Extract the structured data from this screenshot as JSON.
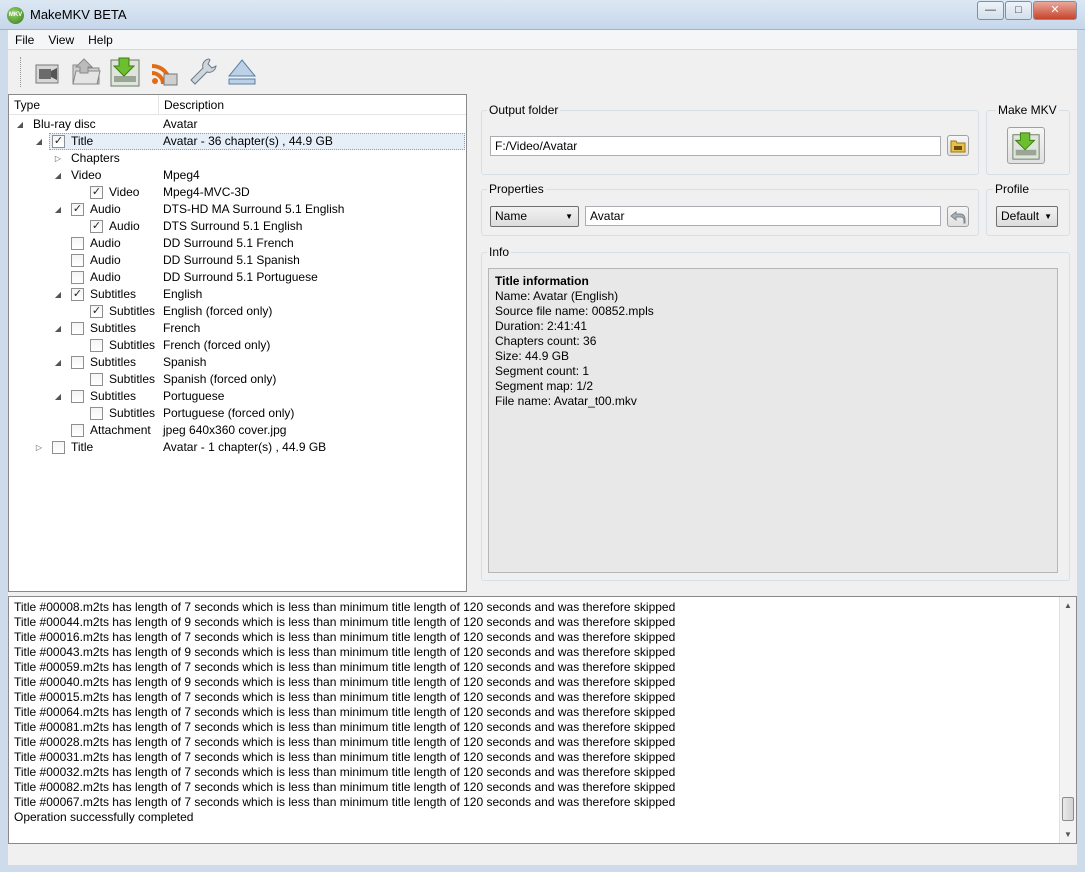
{
  "window": {
    "title": "MakeMKV BETA",
    "app_icon_text": "MKV",
    "minimize": "—",
    "maximize": "□",
    "close": "✕"
  },
  "menu": [
    {
      "label": "File"
    },
    {
      "label": "View"
    },
    {
      "label": "Help"
    }
  ],
  "toolbar": [
    {
      "icon": "open-file-icon"
    },
    {
      "icon": "open-folder-icon"
    },
    {
      "icon": "make-mkv-icon"
    },
    {
      "icon": "stream-icon"
    },
    {
      "icon": "settings-wrench-icon"
    },
    {
      "icon": "eject-icon"
    }
  ],
  "tree": {
    "columns": {
      "type": "Type",
      "description": "Description"
    },
    "rows": [
      {
        "label": "Blu-ray disc",
        "desc": "Avatar",
        "level": 0,
        "expander": "open",
        "checkbox": null
      },
      {
        "label": "Title",
        "desc": "Avatar - 36 chapter(s) , 44.9 GB",
        "level": 1,
        "expander": "open",
        "checkbox": true,
        "selected": true
      },
      {
        "label": "Chapters",
        "desc": "",
        "level": 2,
        "expander": "closed",
        "checkbox": null
      },
      {
        "label": "Video",
        "desc": "Mpeg4",
        "level": 2,
        "expander": "open",
        "checkbox": null
      },
      {
        "label": "Video",
        "desc": "Mpeg4-MVC-3D",
        "level": 3,
        "expander": null,
        "checkbox": true
      },
      {
        "label": "Audio",
        "desc": "DTS-HD MA Surround 5.1 English",
        "level": 2,
        "expander": "open",
        "checkbox": true
      },
      {
        "label": "Audio",
        "desc": "DTS Surround 5.1 English",
        "level": 3,
        "expander": null,
        "checkbox": true
      },
      {
        "label": "Audio",
        "desc": "DD Surround 5.1 French",
        "level": 2,
        "expander": null,
        "checkbox": false
      },
      {
        "label": "Audio",
        "desc": "DD Surround 5.1 Spanish",
        "level": 2,
        "expander": null,
        "checkbox": false
      },
      {
        "label": "Audio",
        "desc": "DD Surround 5.1 Portuguese",
        "level": 2,
        "expander": null,
        "checkbox": false
      },
      {
        "label": "Subtitles",
        "desc": "English",
        "level": 2,
        "expander": "open",
        "checkbox": true
      },
      {
        "label": "Subtitles",
        "desc": "English  (forced only)",
        "level": 3,
        "expander": null,
        "checkbox": true
      },
      {
        "label": "Subtitles",
        "desc": "French",
        "level": 2,
        "expander": "open",
        "checkbox": false
      },
      {
        "label": "Subtitles",
        "desc": "French  (forced only)",
        "level": 3,
        "expander": null,
        "checkbox": false
      },
      {
        "label": "Subtitles",
        "desc": "Spanish",
        "level": 2,
        "expander": "open",
        "checkbox": false
      },
      {
        "label": "Subtitles",
        "desc": "Spanish  (forced only)",
        "level": 3,
        "expander": null,
        "checkbox": false
      },
      {
        "label": "Subtitles",
        "desc": "Portuguese",
        "level": 2,
        "expander": "open",
        "checkbox": false
      },
      {
        "label": "Subtitles",
        "desc": "Portuguese  (forced only)",
        "level": 3,
        "expander": null,
        "checkbox": false
      },
      {
        "label": "Attachment",
        "desc": "jpeg 640x360 cover.jpg",
        "level": 2,
        "expander": null,
        "checkbox": false
      },
      {
        "label": "Title",
        "desc": "Avatar - 1 chapter(s) , 44.9 GB",
        "level": 1,
        "expander": "closed",
        "checkbox": false
      }
    ]
  },
  "output": {
    "group_title": "Output folder",
    "path": "F:/Video/Avatar"
  },
  "make_mkv": {
    "group_title": "Make MKV"
  },
  "properties": {
    "group_title": "Properties",
    "field_select": "Name",
    "value": "Avatar"
  },
  "profile": {
    "group_title": "Profile",
    "selected": "Default"
  },
  "info": {
    "group_title": "Info",
    "title": "Title information",
    "lines": [
      "Name: Avatar (English)",
      "Source file name: 00852.mpls",
      "Duration: 2:41:41",
      "Chapters count: 36",
      "Size: 44.9 GB",
      "Segment count: 1",
      "Segment map: 1/2",
      "File name: Avatar_t00.mkv"
    ]
  },
  "log": [
    "Title #00008.m2ts has length of 7 seconds which is less than minimum title length of 120 seconds and was therefore skipped",
    "Title #00044.m2ts has length of 9 seconds which is less than minimum title length of 120 seconds and was therefore skipped",
    "Title #00016.m2ts has length of 7 seconds which is less than minimum title length of 120 seconds and was therefore skipped",
    "Title #00043.m2ts has length of 9 seconds which is less than minimum title length of 120 seconds and was therefore skipped",
    "Title #00059.m2ts has length of 7 seconds which is less than minimum title length of 120 seconds and was therefore skipped",
    "Title #00040.m2ts has length of 9 seconds which is less than minimum title length of 120 seconds and was therefore skipped",
    "Title #00015.m2ts has length of 7 seconds which is less than minimum title length of 120 seconds and was therefore skipped",
    "Title #00064.m2ts has length of 7 seconds which is less than minimum title length of 120 seconds and was therefore skipped",
    "Title #00081.m2ts has length of 7 seconds which is less than minimum title length of 120 seconds and was therefore skipped",
    "Title #00028.m2ts has length of 7 seconds which is less than minimum title length of 120 seconds and was therefore skipped",
    "Title #00031.m2ts has length of 7 seconds which is less than minimum title length of 120 seconds and was therefore skipped",
    "Title #00032.m2ts has length of 7 seconds which is less than minimum title length of 120 seconds and was therefore skipped",
    "Title #00082.m2ts has length of 7 seconds which is less than minimum title length of 120 seconds and was therefore skipped",
    "Title #00067.m2ts has length of 7 seconds which is less than minimum title length of 120 seconds and was therefore skipped",
    "Operation successfully completed"
  ]
}
